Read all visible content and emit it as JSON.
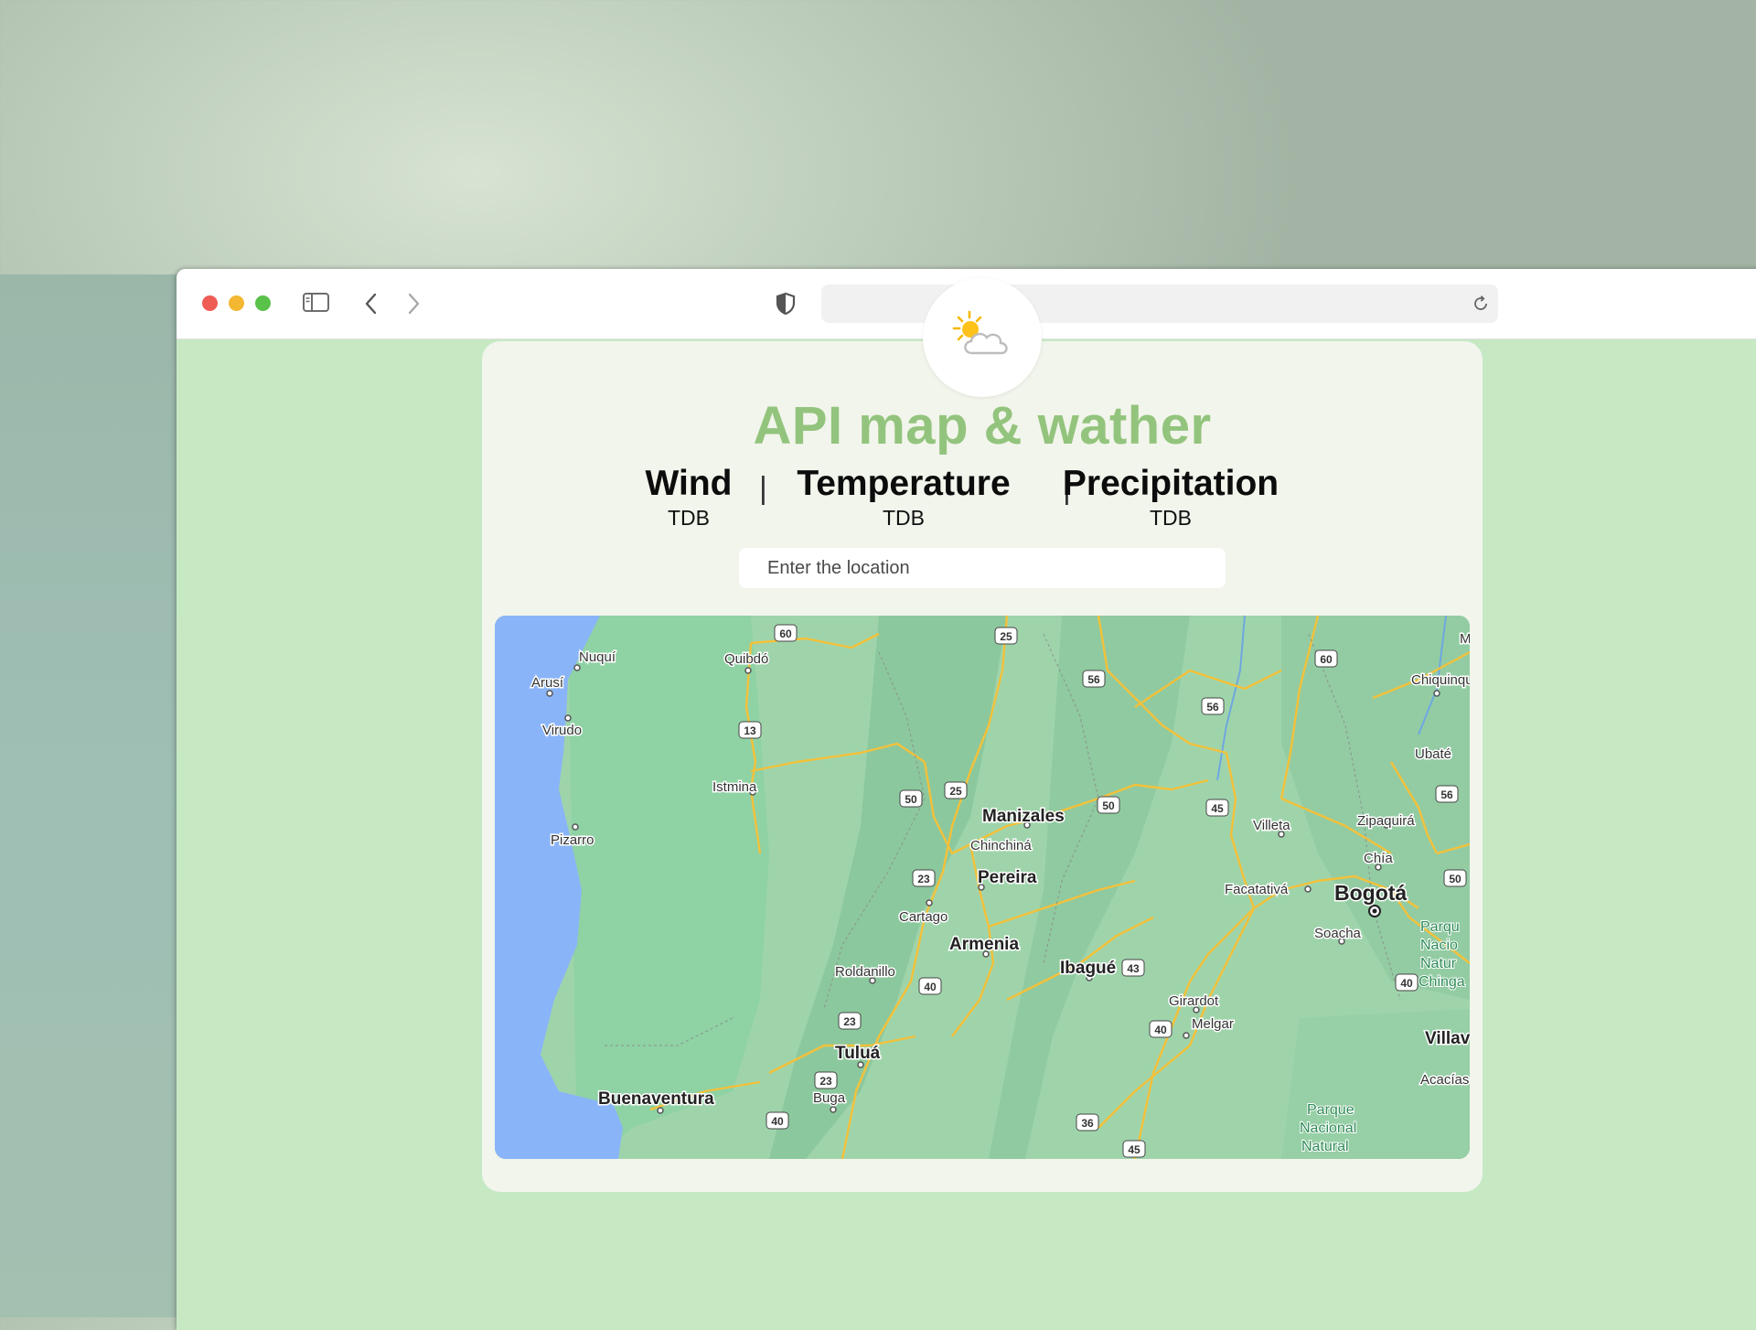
{
  "browser": {
    "url": ""
  },
  "app": {
    "title": "API map & wather"
  },
  "stats": [
    {
      "name": "Wind",
      "value": "TDB"
    },
    {
      "name": "Temperature",
      "value": "TDB"
    },
    {
      "name": "Precipitation",
      "value": "TDB"
    }
  ],
  "separator": "|",
  "search": {
    "placeholder": "Enter the location"
  },
  "map": {
    "labels": {
      "nuqui": "Nuquí",
      "arusi": "Arusí",
      "virudo": "Virudo",
      "pizarro": "Pizarro",
      "quibdo": "Quibdó",
      "istmina": "Istmina",
      "buenaventura": "Buenaventura",
      "manizales": "Manizales",
      "chinchina": "Chinchiná",
      "pereira": "Pereira",
      "cartago": "Cartago",
      "armenia": "Armenia",
      "roldanillo": "Roldanillo",
      "tulua": "Tuluá",
      "buga": "Buga",
      "ibague": "Ibagué",
      "girardot": "Girardot",
      "melgar": "Melgar",
      "villeta": "Villeta",
      "zipaquira": "Zipaquirá",
      "chia": "Chía",
      "facatativa": "Facatativá",
      "bogota": "Bogotá",
      "soacha": "Soacha",
      "ubate": "Ubaté",
      "chiquinquira": "Chiquinquir",
      "parque_chingaza_1": "Parqu",
      "parque_chingaza_2": "Nacio",
      "parque_chingaza_3": "Natur",
      "parque_chingaza_4": "Chinga",
      "villav": "Villav",
      "acacias": "Acacías",
      "parque_nac_1": "Parque",
      "parque_nac_2": "Nacional",
      "parque_nac_3": "Natural",
      "m_edge": "M"
    },
    "routes": {
      "r60a": "60",
      "r25a": "25",
      "r56a": "56",
      "r56b": "56",
      "r60b": "60",
      "r13": "13",
      "r50a": "50",
      "r25b": "25",
      "r50b": "50",
      "r45a": "45",
      "r56c": "56",
      "r23a": "23",
      "r50c": "50",
      "r43": "43",
      "r40a": "40",
      "r40b": "40",
      "r23b": "23",
      "r23c": "23",
      "r40c": "40",
      "r40d": "40",
      "r36": "36",
      "r45b": "45"
    }
  }
}
